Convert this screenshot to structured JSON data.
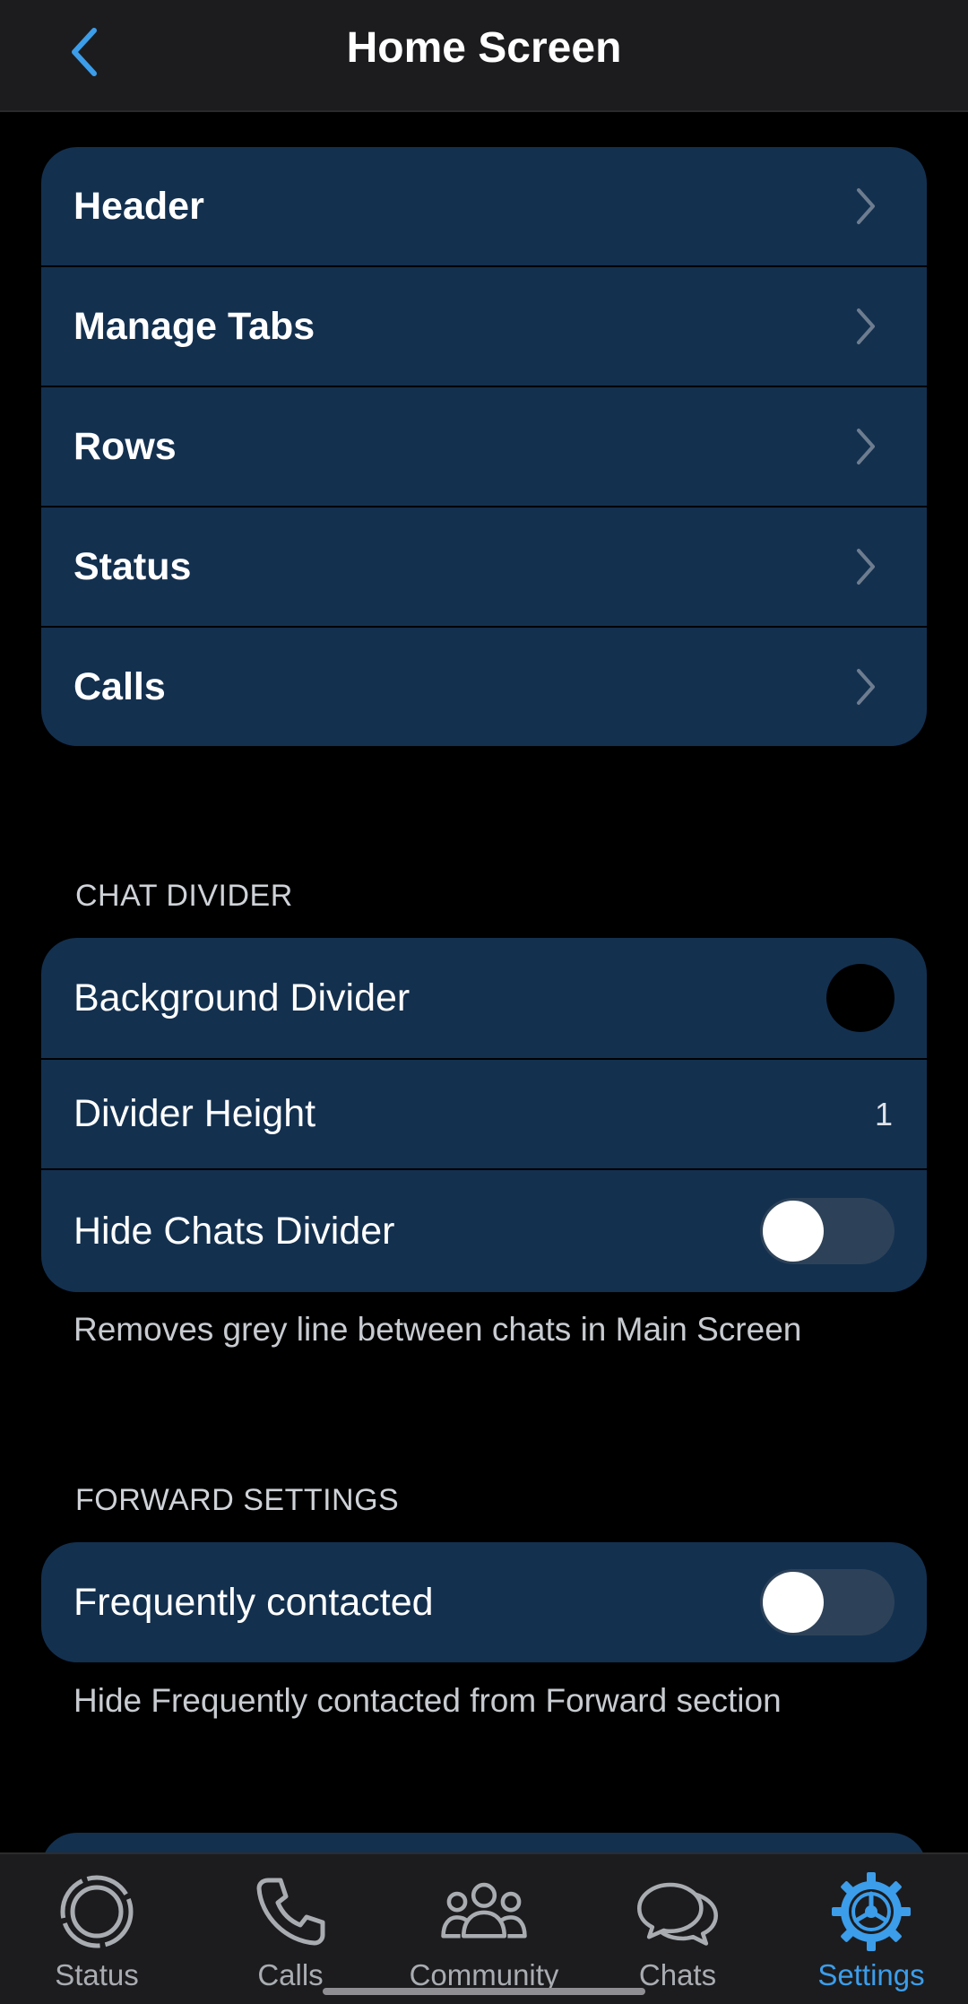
{
  "header": {
    "title": "Home Screen",
    "back_icon": "chevron-left-icon"
  },
  "nav_section": {
    "items": [
      {
        "label": "Header"
      },
      {
        "label": "Manage Tabs"
      },
      {
        "label": "Rows"
      },
      {
        "label": "Status"
      },
      {
        "label": "Calls"
      }
    ]
  },
  "chat_divider": {
    "title": "CHAT DIVIDER",
    "background_divider": {
      "label": "Background Divider",
      "color": "#000000"
    },
    "divider_height": {
      "label": "Divider Height",
      "value": "1"
    },
    "hide_chats_divider": {
      "label": "Hide Chats Divider",
      "enabled": false
    },
    "footnote": "Removes grey line between chats in Main Screen"
  },
  "forward_settings": {
    "title": "FORWARD SETTINGS",
    "frequently_contacted": {
      "label": "Frequently contacted",
      "enabled": false
    },
    "footnote": "Hide Frequently contacted from Forward section"
  },
  "bottom_nav": {
    "items": [
      {
        "label": "Status",
        "icon": "status-icon",
        "active": false
      },
      {
        "label": "Calls",
        "icon": "phone-icon",
        "active": false
      },
      {
        "label": "Community",
        "icon": "community-icon",
        "active": false
      },
      {
        "label": "Chats",
        "icon": "chats-icon",
        "active": false
      },
      {
        "label": "Settings",
        "icon": "settings-icon",
        "active": true
      }
    ]
  },
  "colors": {
    "accent": "#3c9dea",
    "card_bg": "#13304f",
    "page_bg": "#000000",
    "bar_bg": "#1c1c1e"
  }
}
